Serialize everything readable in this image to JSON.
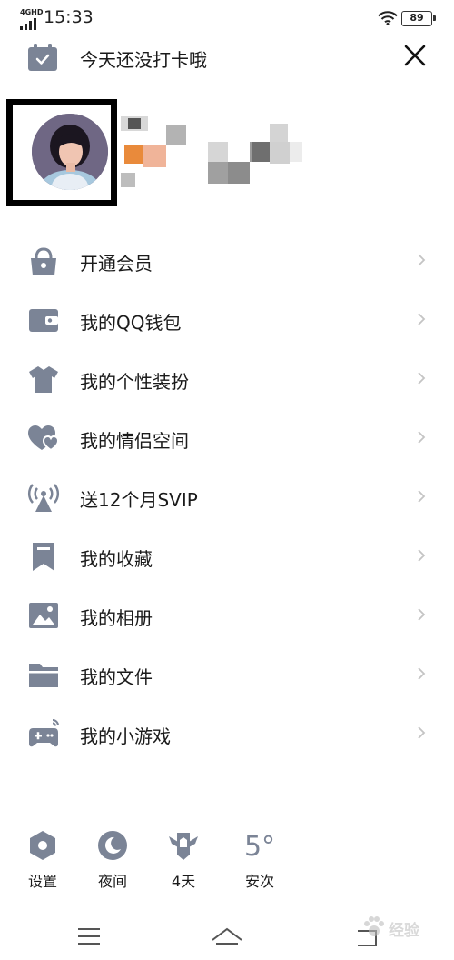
{
  "status_bar": {
    "network": "4GHD",
    "time": "15:33",
    "battery": "89"
  },
  "checkin_banner": {
    "text": "今天还没打卡哦"
  },
  "menu": {
    "items": [
      {
        "label": "开通会员",
        "icon": "vip-bag-icon"
      },
      {
        "label": "我的QQ钱包",
        "icon": "wallet-icon"
      },
      {
        "label": "我的个性装扮",
        "icon": "shirt-icon"
      },
      {
        "label": "我的情侣空间",
        "icon": "hearts-icon"
      },
      {
        "label": "送12个月SVIP",
        "icon": "broadcast-icon"
      },
      {
        "label": "我的收藏",
        "icon": "bookmark-icon"
      },
      {
        "label": "我的相册",
        "icon": "photo-icon"
      },
      {
        "label": "我的文件",
        "icon": "folder-icon"
      },
      {
        "label": "我的小游戏",
        "icon": "gamepad-icon"
      }
    ]
  },
  "bottom_bar": {
    "settings_label": "设置",
    "night_label": "夜间",
    "checkin_days_label": "4天",
    "weather_temp": "5°",
    "weather_city": "安次"
  },
  "watermark": {
    "text": "经验"
  },
  "colors": {
    "icon_gray": "#7b8496",
    "chevron_gray": "#c4c4c4",
    "text_dark": "#1a1a1a"
  }
}
